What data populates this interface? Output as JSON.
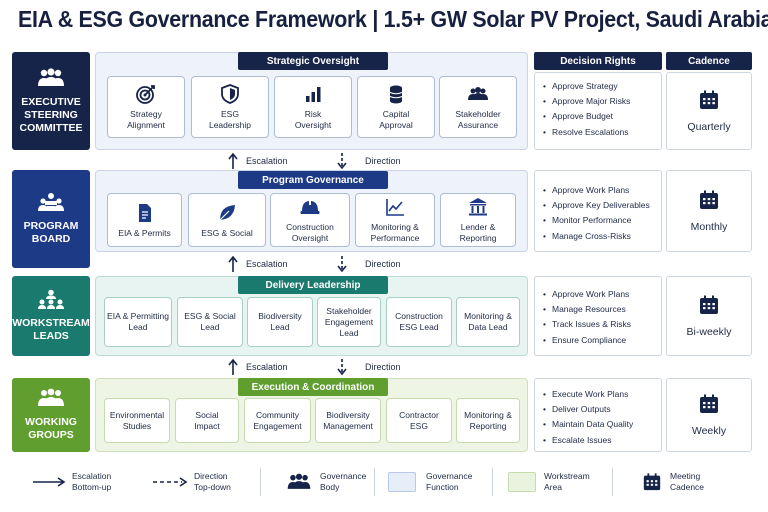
{
  "title": "EIA & ESG Governance Framework | 1.5+ GW Solar PV Project, Saudi Arabia",
  "tiers": [
    {
      "label": "EXECUTIVE\nSTEERING\nCOMMITTEE",
      "icon": "group-icon",
      "color": "#17244a",
      "panel_title": "Strategic Oversight",
      "cards": [
        {
          "label": "Strategy\nAlignment",
          "icon": "target-icon"
        },
        {
          "label": "ESG\nLeadership",
          "icon": "shield-icon"
        },
        {
          "label": "Risk\nOversight",
          "icon": "bar-chart-icon"
        },
        {
          "label": "Capital\nApproval",
          "icon": "coins-icon"
        },
        {
          "label": "Stakeholder\nAssurance",
          "icon": "people-icon"
        }
      ],
      "decision_rights": [
        "Approve Strategy",
        "Approve Major Risks",
        "Approve Budget",
        "Resolve Escalations"
      ],
      "cadence": "Quarterly"
    },
    {
      "label": "PROGRAM\nBOARD",
      "icon": "board-icon",
      "color": "#1d3a87",
      "panel_title": "Program Governance",
      "cards": [
        {
          "label": "EIA & Permits",
          "icon": "document-icon"
        },
        {
          "label": "ESG & Social",
          "icon": "leaf-icon"
        },
        {
          "label": "Construction\nOversight",
          "icon": "hardhat-icon"
        },
        {
          "label": "Monitoring &\nPerformance",
          "icon": "line-chart-icon"
        },
        {
          "label": "Lender &\nReporting",
          "icon": "bank-icon"
        }
      ],
      "decision_rights": [
        "Approve Work Plans",
        "Approve Key Deliverables",
        "Monitor Performance",
        "Manage Cross-Risks"
      ],
      "cadence": "Monthly"
    },
    {
      "label": "WORKSTREAM\nLEADS",
      "icon": "hierarchy-icon",
      "color": "#1a7a6e",
      "panel_title": "Delivery Leadership",
      "cards": [
        {
          "label": "EIA & Permitting\nLead"
        },
        {
          "label": "ESG & Social\nLead"
        },
        {
          "label": "Biodiversity\nLead"
        },
        {
          "label": "Stakeholder\nEngagement\nLead"
        },
        {
          "label": "Construction\nESG Lead"
        },
        {
          "label": "Monitoring &\nData Lead"
        }
      ],
      "decision_rights": [
        "Approve Work Plans",
        "Manage Resources",
        "Track Issues & Risks",
        "Ensure Compliance"
      ],
      "cadence": "Bi-weekly"
    },
    {
      "label": "WORKING\nGROUPS",
      "icon": "team-icon",
      "color": "#5f9e2f",
      "panel_title": "Execution & Coordination",
      "cards": [
        {
          "label": "Environmental\nStudies"
        },
        {
          "label": "Social\nImpact"
        },
        {
          "label": "Community\nEngagement"
        },
        {
          "label": "Biodiversity\nManagement"
        },
        {
          "label": "Contractor\nESG"
        },
        {
          "label": "Monitoring &\nReporting"
        }
      ],
      "decision_rights": [
        "Execute Work Plans",
        "Deliver Outputs",
        "Maintain Data Quality",
        "Escalate Issues"
      ],
      "cadence": "Weekly"
    }
  ],
  "flows": {
    "escalation": "Escalation",
    "direction": "Direction"
  },
  "headers": {
    "decision_rights": "Decision Rights",
    "cadence": "Cadence"
  },
  "legend": {
    "escalation": "Escalation\nBottom-up",
    "direction": "Direction\nTop-down",
    "governance_body": "Governance\nBody",
    "governance_function": "Governance\nFunction",
    "workstream_area": "Workstream\nArea",
    "meeting_cadence": "Meeting\nCadence"
  },
  "colors": {
    "navy": "#17244a",
    "blue": "#1d3a87",
    "teal": "#1a7a6e",
    "green": "#5f9e2f",
    "panel_blue": "#eef3fb",
    "panel_teal": "#e8f4f1",
    "panel_green": "#eef5e4"
  }
}
